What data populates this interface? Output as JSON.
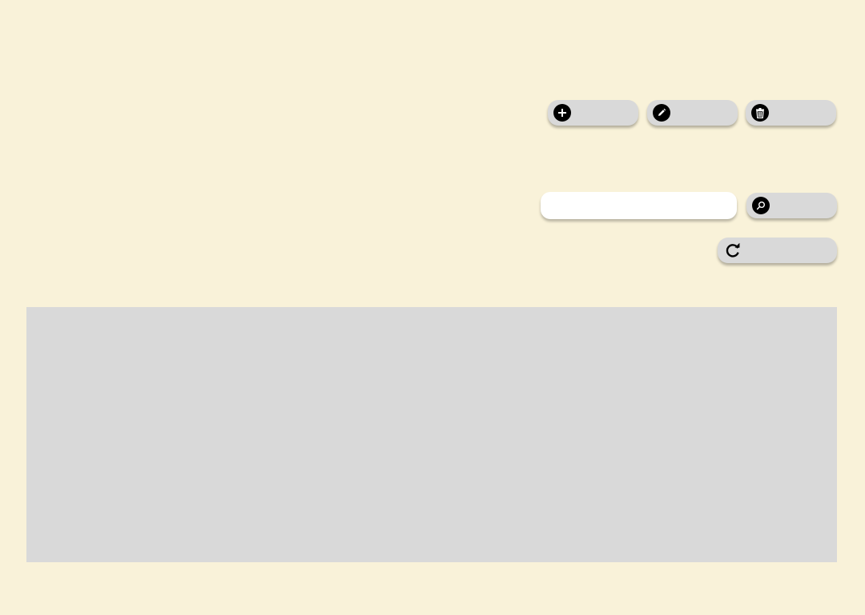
{
  "colors": {
    "page_background": "#f9f2d9",
    "button_background": "#d9d9d9",
    "icon_background": "#000000",
    "input_background": "#ffffff",
    "panel_background": "#d9d9d9"
  },
  "toolbar": {
    "add": {
      "icon": "add-circle-icon",
      "label": ""
    },
    "edit": {
      "icon": "pencil-icon",
      "label": ""
    },
    "delete": {
      "icon": "trash-icon",
      "label": ""
    }
  },
  "search": {
    "value": "",
    "placeholder": "",
    "button": {
      "icon": "search-icon",
      "label": ""
    }
  },
  "refresh": {
    "icon": "refresh-icon",
    "label": ""
  },
  "data_panel": {
    "items": []
  }
}
